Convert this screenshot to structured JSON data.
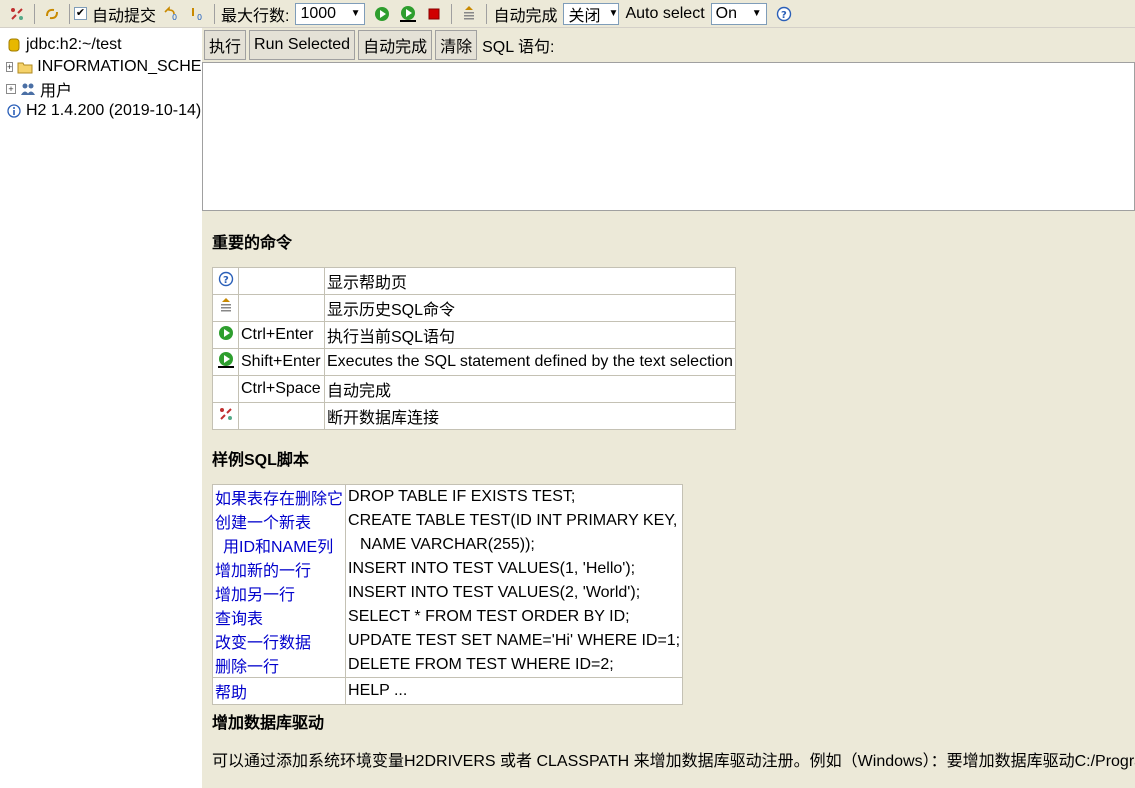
{
  "toolbar": {
    "auto_commit_label": "自动提交",
    "auto_commit_checked": true,
    "max_rows_label": "最大行数:",
    "max_rows_value": "1000",
    "autocomplete_label": "自动完成",
    "autocomplete_value": "关闭",
    "auto_select_label": "Auto select",
    "auto_select_value": "On"
  },
  "tree": {
    "connection": "jdbc:h2:~/test",
    "schema": "INFORMATION_SCHEMA",
    "users": "用户",
    "version": "H2 1.4.200 (2019-10-14)"
  },
  "query": {
    "execute": "执行",
    "run_selected": "Run Selected",
    "autocomplete": "自动完成",
    "clear": "清除",
    "sql_label": "SQL 语句:"
  },
  "help": {
    "important_title": "重要的命令",
    "commands": [
      {
        "icon": "help-icon",
        "key": "",
        "desc": "显示帮助页"
      },
      {
        "icon": "history-icon",
        "key": "",
        "desc": "显示历史SQL命令"
      },
      {
        "icon": "run-icon",
        "key": "Ctrl+Enter",
        "desc": "执行当前SQL语句"
      },
      {
        "icon": "run-selected-icon",
        "key": "Shift+Enter",
        "desc": "Executes the SQL statement defined by the text selection"
      },
      {
        "icon": "",
        "key": "Ctrl+Space",
        "desc": "自动完成"
      },
      {
        "icon": "disconnect-icon",
        "key": "",
        "desc": "断开数据库连接"
      }
    ],
    "samples_title": "样例SQL脚本",
    "samples": [
      {
        "desc": "如果表存在删除它",
        "sql": "DROP TABLE IF EXISTS TEST;"
      },
      {
        "desc": "创建一个新表",
        "sql": "CREATE TABLE TEST(ID INT PRIMARY KEY,"
      },
      {
        "desc": "用ID和NAME列",
        "sql": "NAME VARCHAR(255));"
      },
      {
        "desc": "增加新的一行",
        "sql": "INSERT INTO TEST VALUES(1, 'Hello');"
      },
      {
        "desc": "增加另一行",
        "sql": "INSERT INTO TEST VALUES(2, 'World');"
      },
      {
        "desc": "查询表",
        "sql": "SELECT * FROM TEST ORDER BY ID;"
      },
      {
        "desc": "改变一行数据",
        "sql": "UPDATE TEST SET NAME='Hi' WHERE ID=1;"
      },
      {
        "desc": "删除一行",
        "sql": "DELETE FROM TEST WHERE ID=2;"
      }
    ],
    "help_row": {
      "desc": "帮助",
      "sql": "HELP ..."
    },
    "drivers_title": "增加数据库驱动",
    "drivers_text": "可以通过添加系统环境变量H2DRIVERS 或者 CLASSPATH 来增加数据库驱动注册。例如（Windows）：要增加数据库驱动C:/Programs/hsqldb/lib/hsqldb.jar"
  },
  "colors": {
    "toolbar_bg": "#ece9d8",
    "link": "#0000cc",
    "run_green": "#2e9e2e",
    "stop_red": "#d00000"
  }
}
